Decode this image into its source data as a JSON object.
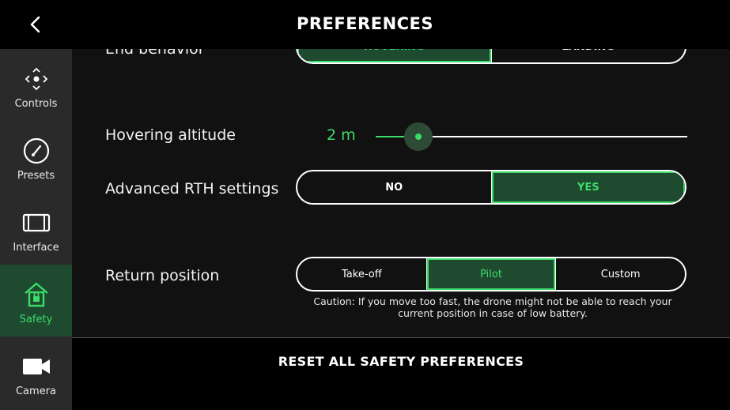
{
  "header": {
    "title": "PREFERENCES",
    "back_icon": "chevron-left-icon"
  },
  "sidebar": {
    "items": [
      {
        "label": "Controls",
        "icon": "controls-icon",
        "active": false
      },
      {
        "label": "Presets",
        "icon": "gauge-icon",
        "active": false
      },
      {
        "label": "Interface",
        "icon": "interface-icon",
        "active": false
      },
      {
        "label": "Safety",
        "icon": "lock-home-icon",
        "active": true
      },
      {
        "label": "Camera",
        "icon": "video-camera-icon",
        "active": false
      }
    ]
  },
  "settings": {
    "end_behavior": {
      "label": "End behavior",
      "options": [
        "HOVERING",
        "LANDING"
      ],
      "selected": "HOVERING"
    },
    "hovering_altitude": {
      "label": "Hovering altitude",
      "value": "2 m",
      "level": 0.138
    },
    "advanced_rth": {
      "label": "Advanced RTH settings",
      "options": [
        "NO",
        "YES"
      ],
      "selected": "YES"
    },
    "return_position": {
      "label": "Return position",
      "options": [
        "Take-off",
        "Pilot",
        "Custom"
      ],
      "selected": "Pilot",
      "caution": "Caution: If you move too fast, the drone might not be able to reach your current position in case of low battery."
    }
  },
  "reset_label": "RESET ALL SAFETY PREFERENCES",
  "colors": {
    "accent": "#3ddc6a",
    "accent_bg": "#1e4a30",
    "sidebar_bg": "#2a2a2a",
    "content_bg": "#111111",
    "bar_bg": "#000000"
  }
}
